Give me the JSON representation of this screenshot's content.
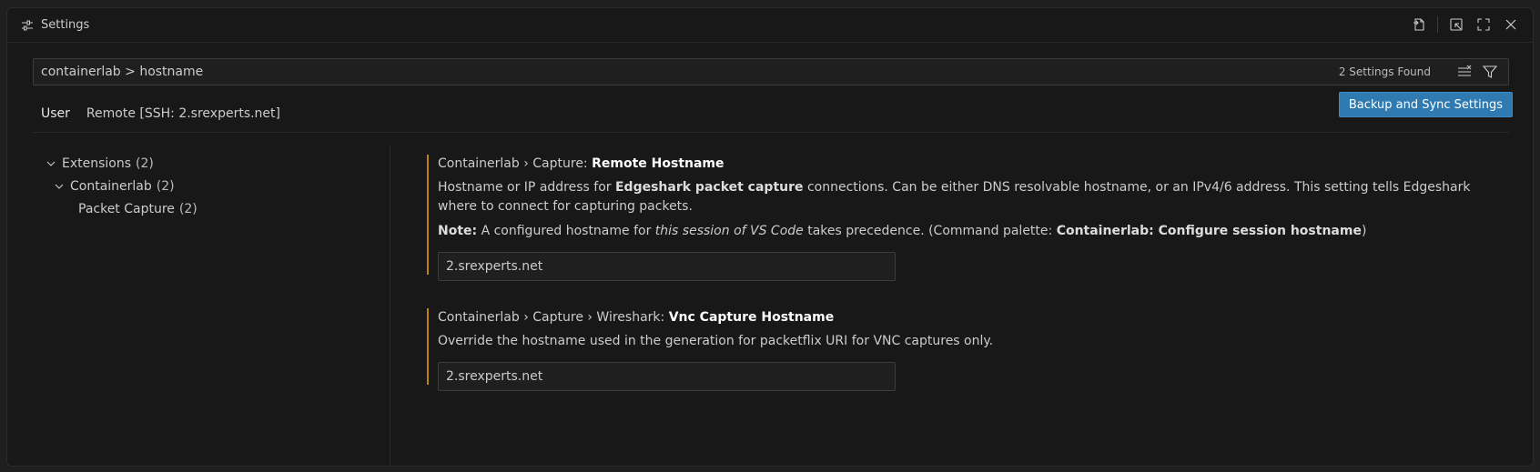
{
  "window": {
    "title": "Settings"
  },
  "search": {
    "value": "containerlab > hostname",
    "result_count": "2 Settings Found"
  },
  "tabs": [
    {
      "label": "User",
      "active": true
    },
    {
      "label": "Remote [SSH: 2.srexperts.net]",
      "active": false
    }
  ],
  "sync_button": {
    "label": "Backup and Sync Settings"
  },
  "toc": [
    {
      "label": "Extensions",
      "count": "(2)",
      "level": 0,
      "expanded": true
    },
    {
      "label": "Containerlab",
      "count": "(2)",
      "level": 1,
      "expanded": true
    },
    {
      "label": "Packet Capture",
      "count": "(2)",
      "level": 2,
      "expanded": false
    }
  ],
  "settings": [
    {
      "category": "Containerlab › Capture: ",
      "name": "Remote Hostname",
      "desc_pre": "Hostname or IP address for ",
      "desc_bold": "Edgeshark packet capture",
      "desc_post": " connections. Can be either DNS resolvable hostname, or an IPv4/6 address. This setting tells Edgeshark where to connect for capturing packets.",
      "note_label": "Note:",
      "note_pre": " A configured hostname for ",
      "note_italic": "this session of VS Code",
      "note_mid": " takes precedence. (Command palette: ",
      "note_bold": "Containerlab: Configure session hostname",
      "note_post": ")",
      "value": "2.srexperts.net"
    },
    {
      "category": "Containerlab › Capture › Wireshark: ",
      "name": "Vnc Capture Hostname",
      "desc": "Override the hostname used in the generation for packetflix URI for VNC captures only.",
      "value": "2.srexperts.net"
    }
  ],
  "colors": {
    "accent_button": "#2f7bb1",
    "modified_bar": "#b8860b",
    "background": "#181818"
  },
  "icons": {
    "title": "settings-sliders-icon",
    "actions": [
      "open-json-icon",
      "open-settings-editor-icon",
      "maximize-icon",
      "close-icon"
    ],
    "search": [
      "clear-filter-icon",
      "filter-icon"
    ]
  }
}
